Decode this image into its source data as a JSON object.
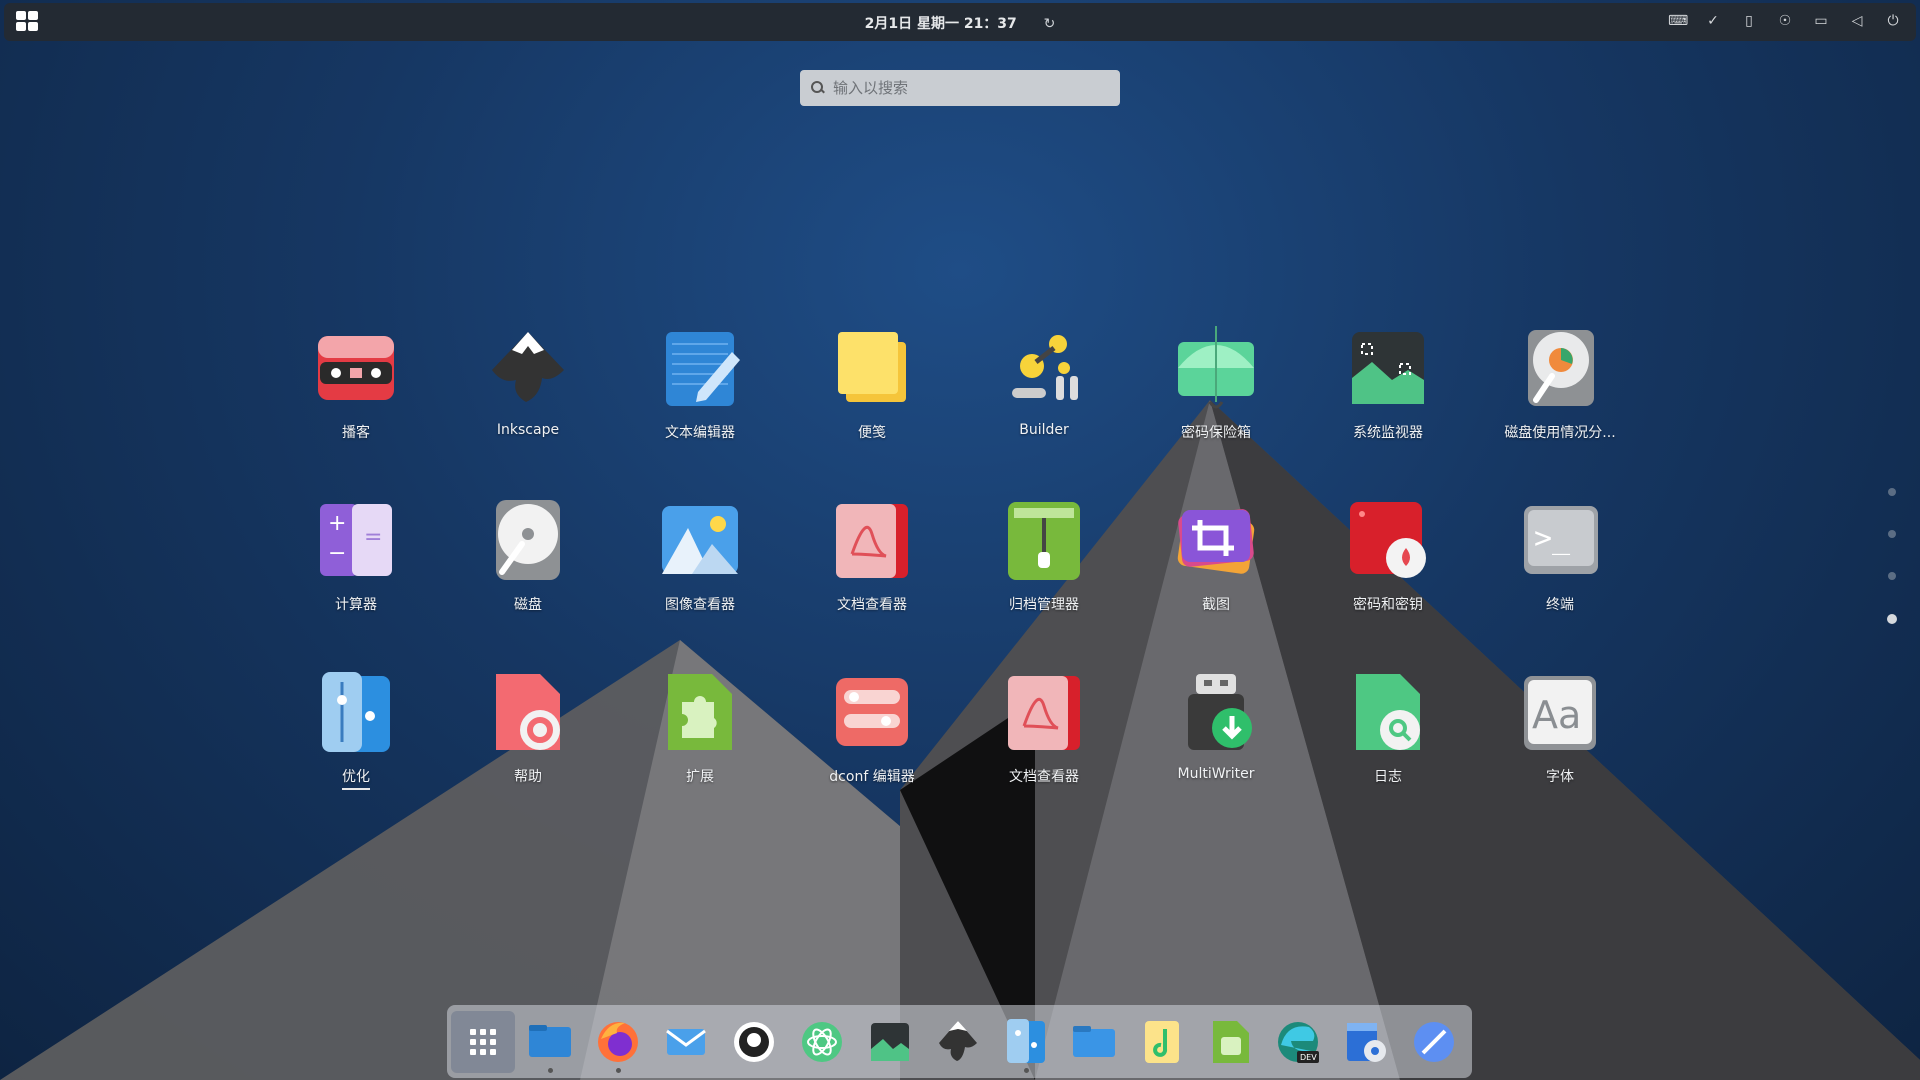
{
  "topbar": {
    "clock": "2月1日 星期一  21：37",
    "refresh_glyph": "↻",
    "tray_icons": [
      "keyboard-icon",
      "check-circle-icon",
      "clipboard-icon",
      "accessibility-icon",
      "network-icon",
      "volume-icon",
      "power-icon"
    ]
  },
  "search": {
    "placeholder": "输入以搜索"
  },
  "apps": [
    {
      "label": "播客",
      "icon": "podcast-icon"
    },
    {
      "label": "Inkscape",
      "icon": "inkscape-icon"
    },
    {
      "label": "文本编辑器",
      "icon": "text-editor-icon"
    },
    {
      "label": "便笺",
      "icon": "sticky-notes-icon"
    },
    {
      "label": "Builder",
      "icon": "builder-icon"
    },
    {
      "label": "密码保险箱",
      "icon": "password-safe-icon"
    },
    {
      "label": "系统监视器",
      "icon": "system-monitor-icon"
    },
    {
      "label": "磁盘使用情况分...",
      "icon": "disk-usage-icon"
    },
    {
      "label": "计算器",
      "icon": "calculator-icon"
    },
    {
      "label": "磁盘",
      "icon": "disks-icon"
    },
    {
      "label": "图像查看器",
      "icon": "image-viewer-icon"
    },
    {
      "label": "文档查看器",
      "icon": "document-viewer-icon"
    },
    {
      "label": "归档管理器",
      "icon": "archive-manager-icon"
    },
    {
      "label": "截图",
      "icon": "screenshot-icon"
    },
    {
      "label": "密码和密钥",
      "icon": "passwords-keys-icon"
    },
    {
      "label": "终端",
      "icon": "terminal-icon"
    },
    {
      "label": "优化",
      "icon": "tweaks-icon"
    },
    {
      "label": "帮助",
      "icon": "help-icon"
    },
    {
      "label": "扩展",
      "icon": "extensions-icon"
    },
    {
      "label": "dconf 编辑器",
      "icon": "dconf-editor-icon"
    },
    {
      "label": "文档查看器",
      "icon": "document-viewer-icon"
    },
    {
      "label": "MultiWriter",
      "icon": "multiwriter-icon"
    },
    {
      "label": "日志",
      "icon": "logs-icon"
    },
    {
      "label": "字体",
      "icon": "fonts-icon"
    }
  ],
  "page_dots": 4,
  "active_page": 4,
  "dock": [
    {
      "icon": "app-grid-icon",
      "running": false
    },
    {
      "icon": "files-icon",
      "running": true
    },
    {
      "icon": "firefox-icon",
      "running": true
    },
    {
      "icon": "mail-icon",
      "running": false
    },
    {
      "icon": "github-icon",
      "running": false
    },
    {
      "icon": "atom-icon",
      "running": false
    },
    {
      "icon": "system-monitor-icon",
      "running": false
    },
    {
      "icon": "inkscape-icon",
      "running": false
    },
    {
      "icon": "tweaks-icon",
      "running": true
    },
    {
      "icon": "folder-icon",
      "running": false
    },
    {
      "icon": "music-icon",
      "running": false
    },
    {
      "icon": "extensions-icon",
      "running": false
    },
    {
      "icon": "edge-dev-icon",
      "running": false
    },
    {
      "icon": "installer-icon",
      "running": false
    },
    {
      "icon": "compass-icon",
      "running": false
    }
  ],
  "colors": {
    "topbar": "#232a33",
    "background": "#163763"
  }
}
